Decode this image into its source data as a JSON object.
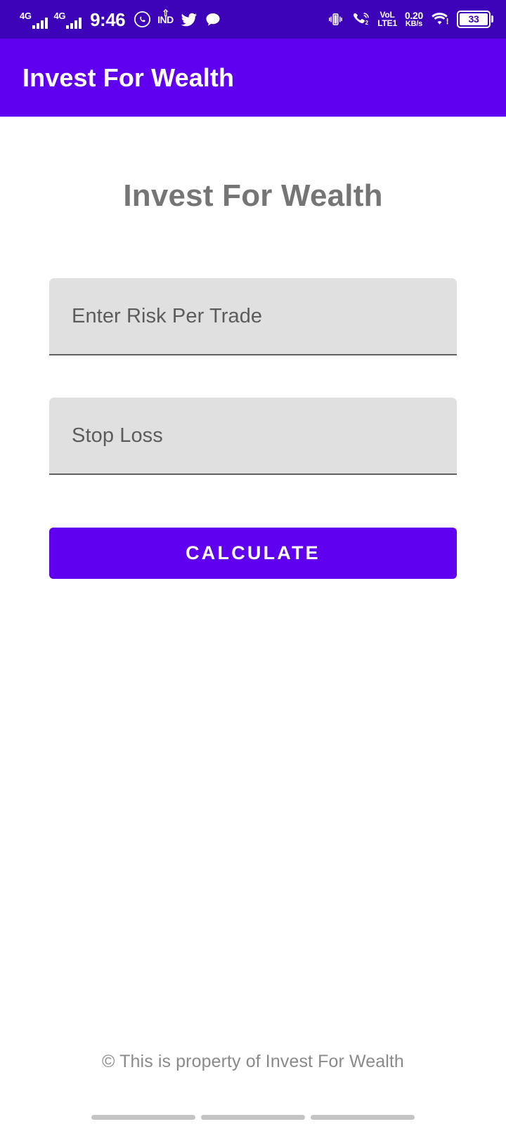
{
  "status_bar": {
    "background_color": "#3C03B8",
    "network_left": {
      "label": "4G",
      "bars": 4
    },
    "network_right": {
      "label": "4G",
      "bars": 4
    },
    "time": "9:46",
    "icons_left": [
      "whatsapp-icon",
      "ind-location-icon",
      "twitter-icon",
      "chat-bubble-icon"
    ],
    "ind_label": "IND",
    "vibrate_icon": "vibrate-icon",
    "wifi_calling_icon": "wifi-calling-icon",
    "wifi_calling_sim": "2",
    "volte": {
      "line1": "VoLTE",
      "line2": "LTE1",
      "sim": "1"
    },
    "volte_top": "VoL",
    "volte_bottom": "LTE1",
    "net_speed": {
      "value": "0.20",
      "unit": "KB/s"
    },
    "wifi_icon": "wifi-icon",
    "battery": {
      "level": "33"
    }
  },
  "app_bar": {
    "title": "Invest For Wealth",
    "background_color": "#5F00EE",
    "text_color": "#FFFFFF"
  },
  "main": {
    "page_title": "Invest For Wealth",
    "page_title_color": "#757575",
    "fields": [
      {
        "name": "risk-per-trade",
        "placeholder": "Enter Risk Per Trade",
        "value": ""
      },
      {
        "name": "stop-loss",
        "placeholder": "Stop Loss",
        "value": ""
      }
    ],
    "calculate_button": {
      "label": "CALCULATE",
      "background_color": "#5F00EE",
      "text_color": "#FFFFFF"
    }
  },
  "footer": {
    "text": "© This is property of Invest For Wealth",
    "color": "#8A8A8A"
  },
  "nav_bar": {
    "pills": 3,
    "color": "#C4C4C4"
  }
}
